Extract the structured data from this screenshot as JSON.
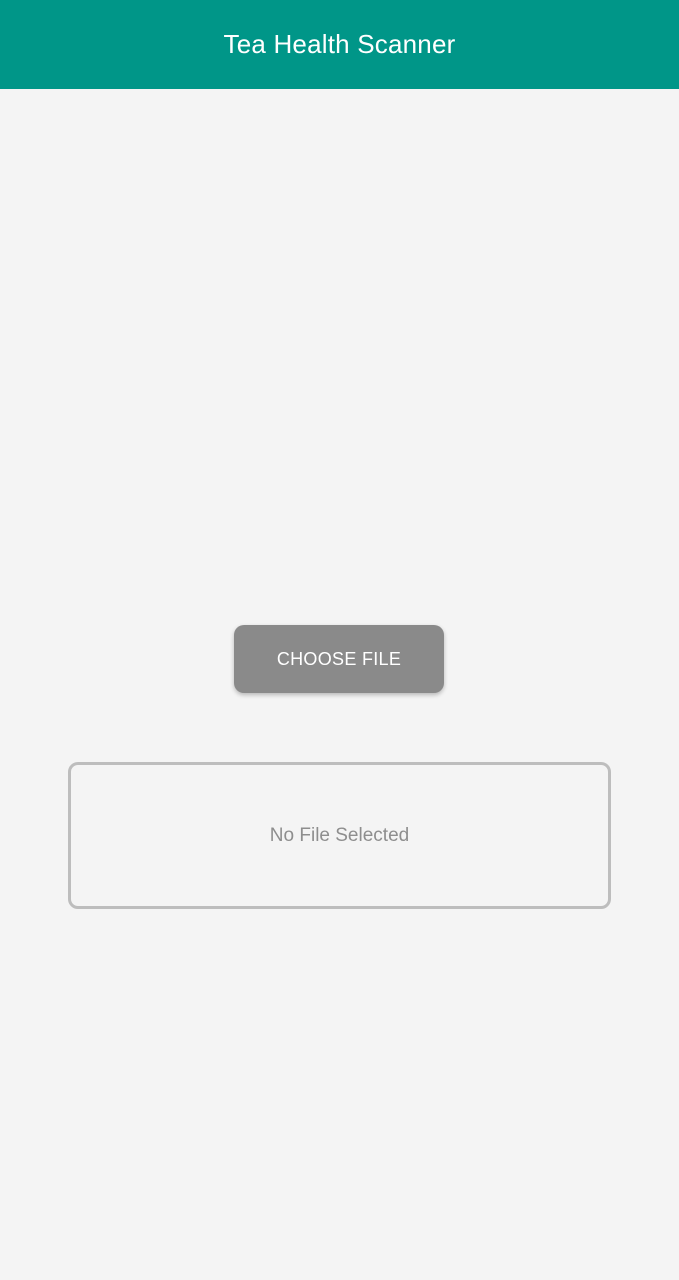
{
  "app_bar": {
    "title": "Tea Health Scanner",
    "background_color": "#009688"
  },
  "main": {
    "choose_file_button": {
      "label": "CHOOSE FILE",
      "background_color": "#8a8a8a"
    },
    "file_status": {
      "text": "No File Selected"
    }
  }
}
